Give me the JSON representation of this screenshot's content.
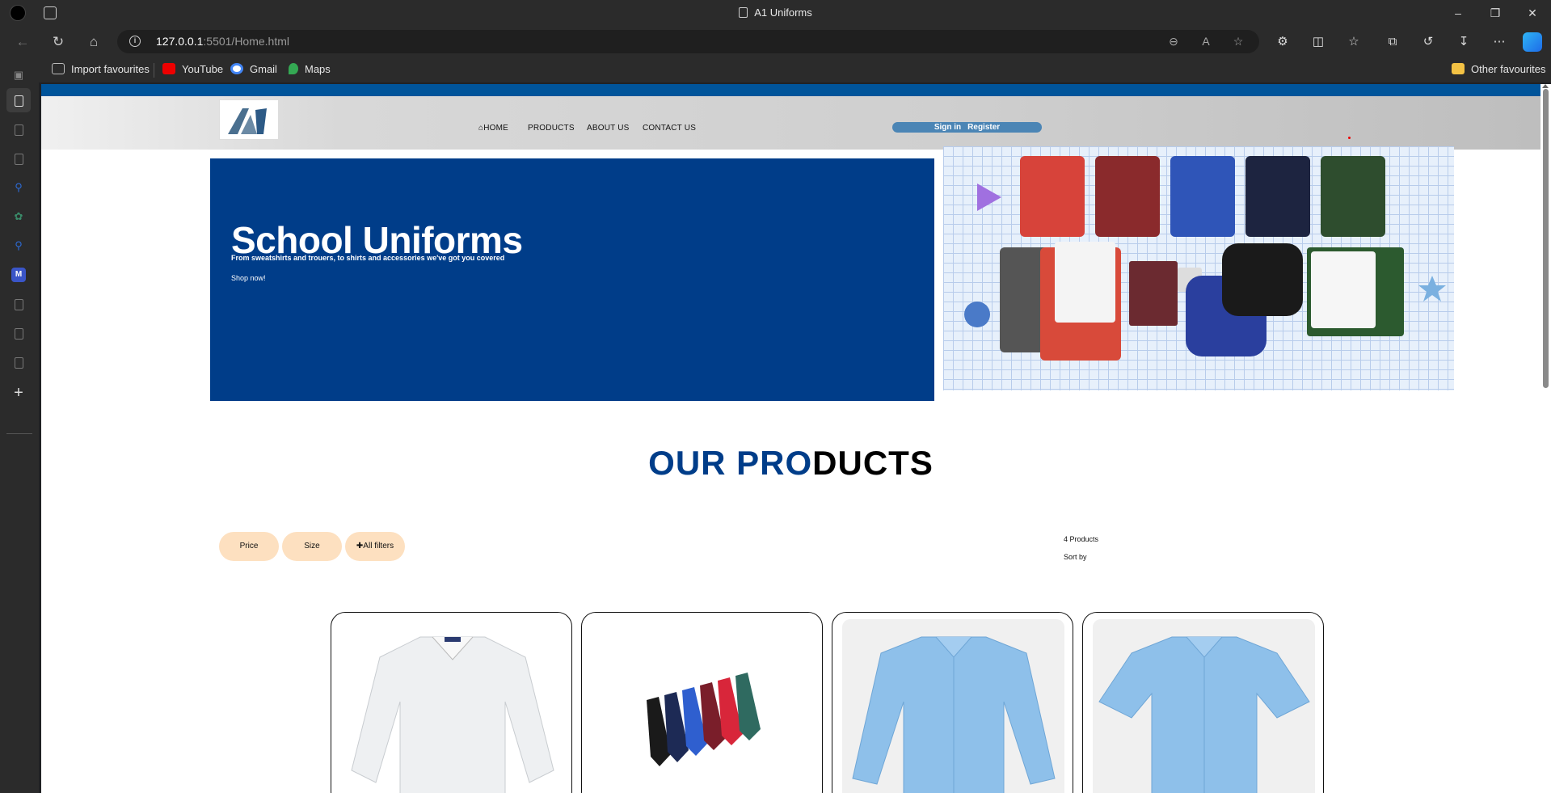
{
  "browser": {
    "window_title": "A1 Uniforms",
    "url_host": "127.0.0.1",
    "url_path": ":5501/Home.html",
    "bookmarks": [
      {
        "label": "Import favourites"
      },
      {
        "label": "YouTube"
      },
      {
        "label": "Gmail"
      },
      {
        "label": "Maps"
      }
    ],
    "other_favourites": "Other favourites"
  },
  "site": {
    "nav": {
      "home": "HOME",
      "products": "PRODUCTS",
      "about": "ABOUT US",
      "contact": "CONTACT US"
    },
    "auth": {
      "signin": "Sign in",
      "register": "Register"
    },
    "hero": {
      "title": "School Uniforms",
      "subtitle": "From sweatshirts and trouers, to shirts and accessories we've got you covered",
      "cta": "Shop now!"
    },
    "products_heading_part1": "OUR PRO",
    "products_heading_part2": "DUCTS",
    "filters": {
      "price": "Price",
      "size": "Size",
      "all": "All filters"
    },
    "product_count": "4 Products",
    "sort_label": "Sort by"
  },
  "colors": {
    "brand_blue": "#003d89",
    "top_bar": "#00549a",
    "filter_pill": "#fde0c0"
  }
}
